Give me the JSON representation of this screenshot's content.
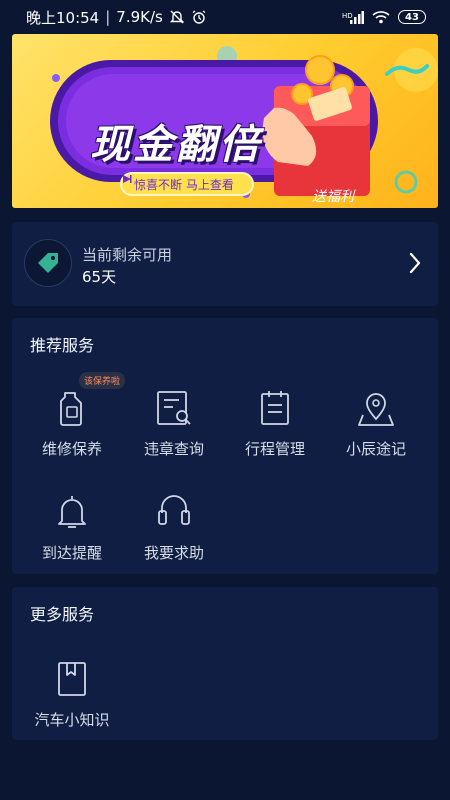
{
  "status_bar": {
    "time": "晚上10:54",
    "network_speed": "7.9K/s",
    "battery": "43",
    "icons": [
      "mute-icon",
      "alarm-icon",
      "signal-icon",
      "wifi-icon",
      "battery-icon"
    ]
  },
  "banner": {
    "title": "现金翻倍",
    "pill_text": "惊喜不断 马上查看",
    "gift_text": "送福利"
  },
  "remain": {
    "label": "当前剩余可用",
    "value": "65天",
    "icon": "tag-icon"
  },
  "recommended": {
    "title": "推荐服务",
    "badge": "该保养啦",
    "items": [
      {
        "label": "维修保养",
        "icon": "oil-bottle-icon"
      },
      {
        "label": "违章查询",
        "icon": "document-search-icon"
      },
      {
        "label": "行程管理",
        "icon": "clipboard-icon"
      },
      {
        "label": "小辰途记",
        "icon": "map-pin-icon"
      },
      {
        "label": "到达提醒",
        "icon": "bell-icon"
      },
      {
        "label": "我要求助",
        "icon": "headset-icon"
      }
    ]
  },
  "more": {
    "title": "更多服务",
    "items": [
      {
        "label": "汽车小知识",
        "icon": "book-icon"
      }
    ]
  },
  "colors": {
    "background": "#0b1633",
    "card": "#0f1e42",
    "banner_yellow": "#ffcc2e",
    "banner_purple": "#6b2bd0",
    "badge_text": "#ff8a5c"
  }
}
